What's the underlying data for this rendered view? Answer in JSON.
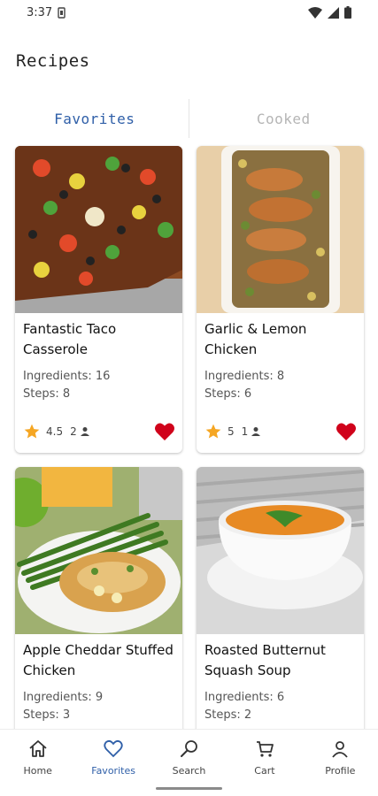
{
  "status_bar": {
    "time": "3:37"
  },
  "page": {
    "title": "Recipes"
  },
  "tabs": [
    {
      "label": "Favorites",
      "active": true
    },
    {
      "label": "Cooked",
      "active": false
    }
  ],
  "recipes": [
    {
      "title": "Fantastic Taco Casserole",
      "ingredients": "Ingredients: 16",
      "steps": "Steps: 8",
      "rating": "4.5",
      "rating_count": "2",
      "favorite": true
    },
    {
      "title": "Garlic & Lemon Chicken",
      "ingredients": "Ingredients: 8",
      "steps": "Steps: 6",
      "rating": "5",
      "rating_count": "1",
      "favorite": true
    },
    {
      "title": "Apple Cheddar Stuffed Chicken",
      "ingredients": "Ingredients: 9",
      "steps": "Steps: 3"
    },
    {
      "title": "Roasted Butternut Squash Soup",
      "ingredients": "Ingredients: 6",
      "steps": "Steps: 2"
    }
  ],
  "bottom_nav": [
    {
      "label": "Home",
      "icon": "home-icon"
    },
    {
      "label": "Favorites",
      "icon": "heart-outline-icon",
      "active": true
    },
    {
      "label": "Search",
      "icon": "search-icon"
    },
    {
      "label": "Cart",
      "icon": "cart-icon"
    },
    {
      "label": "Profile",
      "icon": "person-icon"
    }
  ],
  "colors": {
    "accent": "#2f5fa8",
    "favorite": "#d0021b",
    "star": "#f5a623"
  }
}
